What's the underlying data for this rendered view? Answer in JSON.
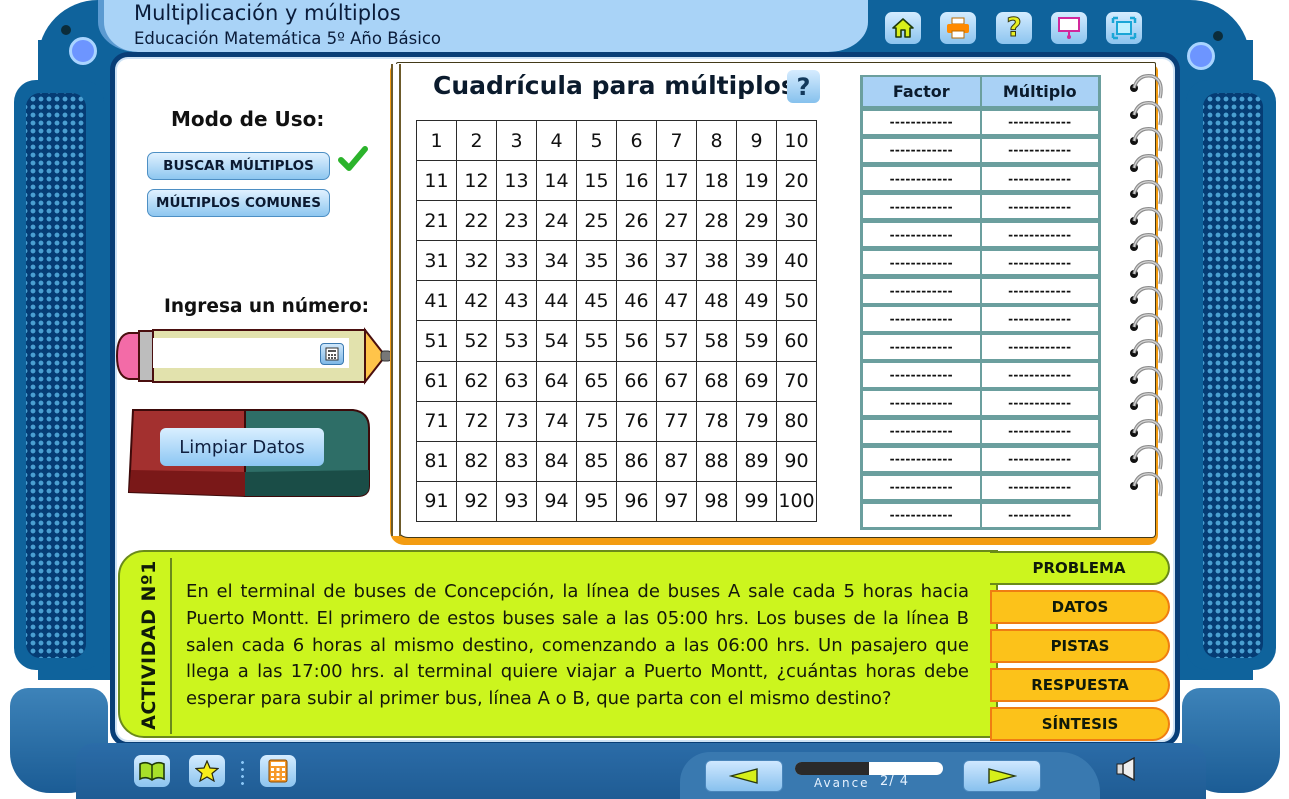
{
  "header": {
    "title": "Multiplicación y múltiplos",
    "subtitle": "Educación Matemática 5º Año Básico",
    "toolbar": [
      {
        "name": "home-icon",
        "label": "Inicio"
      },
      {
        "name": "print-icon",
        "label": "Imprimir"
      },
      {
        "name": "help-icon",
        "label": "Ayuda"
      },
      {
        "name": "presentation-icon",
        "label": "Pizarra"
      },
      {
        "name": "fullscreen-icon",
        "label": "Pantalla completa"
      }
    ]
  },
  "left_panel": {
    "mode_label": "Modo de Uso:",
    "modes": [
      {
        "label": "BUSCAR MÚLTIPLOS",
        "selected": true
      },
      {
        "label": "MÚLTIPLOS COMUNES",
        "selected": false
      }
    ],
    "input_label": "Ingresa un número:",
    "input_value": "",
    "clear_label": "Limpiar Datos"
  },
  "grid": {
    "title": "Cuadrícula para múltiplos",
    "help_label": "?",
    "rows": 10,
    "cols": 10,
    "start": 1,
    "end": 100
  },
  "factor_table": {
    "headers": [
      "Factor",
      "Múltiplo"
    ],
    "rows": [
      [
        "------------",
        "------------"
      ],
      [
        "------------",
        "------------"
      ],
      [
        "------------",
        "------------"
      ],
      [
        "------------",
        "------------"
      ],
      [
        "------------",
        "------------"
      ],
      [
        "------------",
        "------------"
      ],
      [
        "------------",
        "------------"
      ],
      [
        "------------",
        "------------"
      ],
      [
        "------------",
        "------------"
      ],
      [
        "------------",
        "------------"
      ],
      [
        "------------",
        "------------"
      ],
      [
        "------------",
        "------------"
      ],
      [
        "------------",
        "------------"
      ],
      [
        "------------",
        "------------"
      ],
      [
        "------------",
        "------------"
      ]
    ]
  },
  "activity": {
    "label": "ACTIVIDAD Nº1",
    "text": "En el terminal de buses de Concepción, la línea de buses A sale cada 5 horas hacia Puerto Montt. El primero de estos buses sale a las 05:00 hrs. Los  buses de la línea B salen cada 6 horas al mismo destino, comenzando a las 06:00 hrs. Un pasajero que llega a las 17:00 hrs. al terminal quiere viajar a Puerto Montt, ¿cuántas horas debe esperar para subir al primer bus, línea A o B, que parta con el mismo destino?",
    "tabs": [
      {
        "label": "PROBLEMA",
        "active": true
      },
      {
        "label": "DATOS",
        "active": false
      },
      {
        "label": "PISTAS",
        "active": false
      },
      {
        "label": "RESPUESTA",
        "active": false
      },
      {
        "label": "SÍNTESIS",
        "active": false
      }
    ]
  },
  "footer": {
    "tools": [
      {
        "name": "book-icon"
      },
      {
        "name": "star-icon"
      },
      {
        "name": "calculator-icon"
      }
    ],
    "progress_label": "Avance",
    "progress_text": "2/ 4",
    "progress_current": 2,
    "progress_total": 4
  },
  "colors": {
    "frame": "#0f639c",
    "activity_bg": "#ccf51e",
    "tab_inactive": "#fcc21a",
    "accent_orange": "#f39c12"
  }
}
